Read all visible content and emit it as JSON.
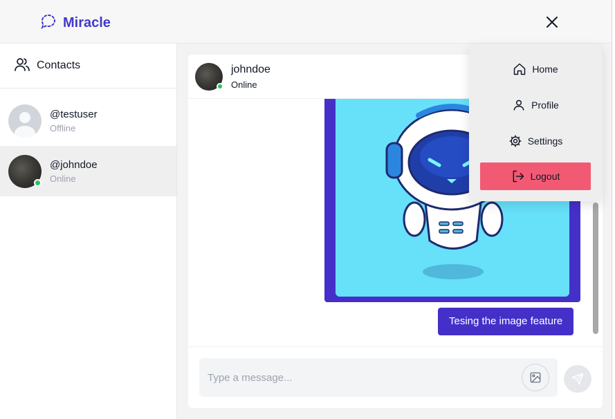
{
  "app": {
    "name": "Miracle",
    "brand_color": "#4338ca"
  },
  "sidebar": {
    "title": "Contacts",
    "contacts": [
      {
        "username": "@testuser",
        "status": "Offline"
      },
      {
        "username": "@johndoe",
        "status": "Online"
      }
    ]
  },
  "chat": {
    "user": "johndoe",
    "status": "Online",
    "messages": {
      "image_alt": "astronaut robot illustration",
      "text": "Tesing the image feature"
    },
    "composer": {
      "placeholder": "Type a message..."
    }
  },
  "menu": {
    "items": [
      {
        "label": "Home",
        "icon": "home-icon"
      },
      {
        "label": "Profile",
        "icon": "user-icon"
      },
      {
        "label": "Settings",
        "icon": "gear-icon"
      },
      {
        "label": "Logout",
        "icon": "logout-icon"
      }
    ]
  },
  "colors": {
    "accent": "#4430c8",
    "online": "#22c55e",
    "logout": "#f25a74",
    "image_bg": "#67e0fa"
  }
}
